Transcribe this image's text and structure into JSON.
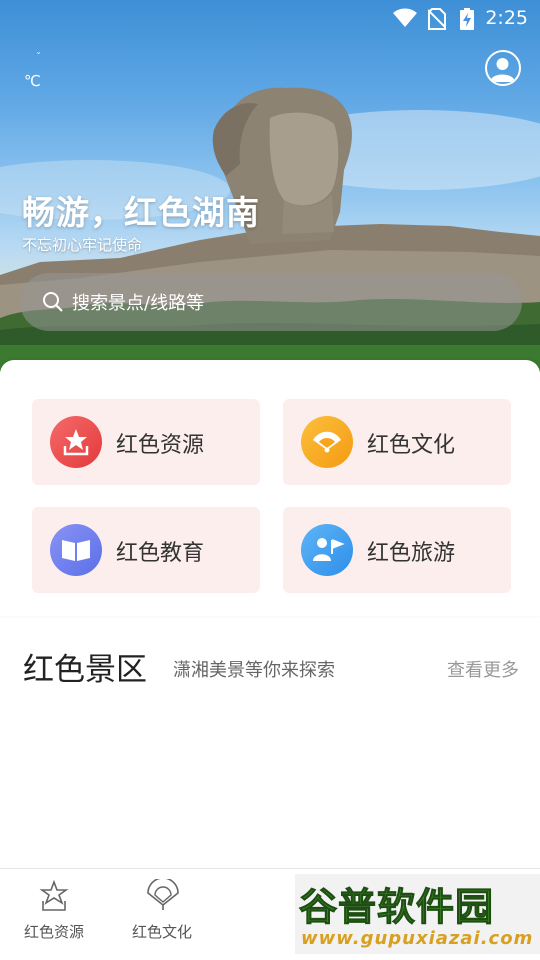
{
  "status_bar": {
    "time": "2:25",
    "icons": [
      "wifi-icon",
      "no-sim-icon",
      "battery-charging-icon"
    ]
  },
  "weather": {
    "icon": "weather-icon",
    "unit": "℃"
  },
  "hero": {
    "title": "畅游，红色湖南",
    "subtitle": "不忘初心牢记使命"
  },
  "search": {
    "placeholder": "搜索景点/线路等"
  },
  "categories": [
    {
      "label": "红色资源",
      "icon": "red-star-icon",
      "color": "#ef4b4b"
    },
    {
      "label": "红色文化",
      "icon": "fan-icon",
      "color": "#f7a51c"
    },
    {
      "label": "红色教育",
      "icon": "book-icon",
      "color": "#6b7ef0"
    },
    {
      "label": "红色旅游",
      "icon": "tour-guide-icon",
      "color": "#3d9cf0"
    }
  ],
  "section": {
    "title": "红色景区",
    "subtitle": "潇湘美景等你来探索",
    "more": "查看更多"
  },
  "bottom_nav": [
    {
      "label": "红色资源",
      "icon": "star-outline-icon"
    },
    {
      "label": "红色文化",
      "icon": "fan-outline-icon"
    }
  ],
  "watermark": {
    "logo": "谷普软件园",
    "url": "www.gupuxiazai.com"
  },
  "colors": {
    "card_bg": "#fdeeee",
    "accent_red": "#ef4b4b"
  }
}
